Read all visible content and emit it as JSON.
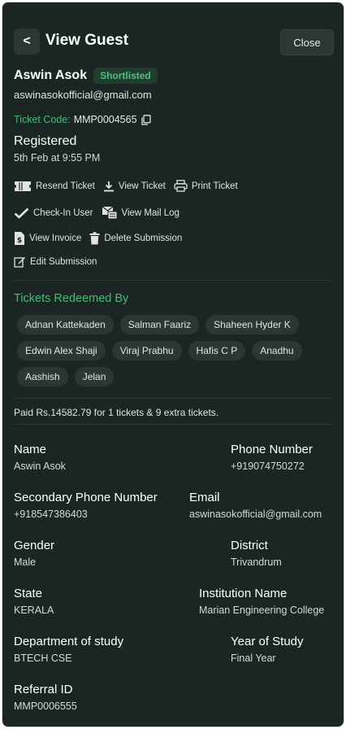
{
  "header": {
    "back_label": "<",
    "title": "View Guest",
    "close_label": "Close"
  },
  "guest": {
    "name": "Aswin Asok",
    "status_badge": "Shortlisted",
    "email": "aswinasokofficial@gmail.com",
    "ticket_code_label": "Ticket Code:",
    "ticket_code": "MMP0004565",
    "registration_status": "Registered",
    "registration_date": "5th Feb at 9:55 PM"
  },
  "actions": {
    "resend_ticket": "Resend Ticket",
    "view_ticket": "View Ticket",
    "print_ticket": "Print Ticket",
    "check_in_user": "Check-In User",
    "view_mail_log": "View Mail Log",
    "view_invoice": "View Invoice",
    "delete_submission": "Delete Submission",
    "edit_submission": "Edit Submission"
  },
  "redeemed": {
    "title": "Tickets Redeemed By",
    "names": [
      "Adnan Kattekaden",
      "Salman Faariz",
      "Shaheen Hyder K",
      "Edwin Alex Shaji",
      "Viraj Prabhu",
      "Hafis C P",
      "Anadhu",
      "Aashish",
      "Jelan"
    ]
  },
  "payment_summary": "Paid Rs.14582.79 for 1 tickets & 9 extra tickets.",
  "details": {
    "name": {
      "label": "Name",
      "value": "Aswin Asok"
    },
    "phone": {
      "label": "Phone Number",
      "value": "+919074750272"
    },
    "secondary_phone": {
      "label": "Secondary Phone Number",
      "value": "+918547386403"
    },
    "email": {
      "label": "Email",
      "value": "aswinasokofficial@gmail.com"
    },
    "gender": {
      "label": "Gender",
      "value": "Male"
    },
    "district": {
      "label": "District",
      "value": "Trivandrum"
    },
    "state": {
      "label": "State",
      "value": "KERALA"
    },
    "institution": {
      "label": "Institution Name",
      "value": "Marian Engineering College"
    },
    "department": {
      "label": "Department of study",
      "value": "BTECH CSE"
    },
    "year": {
      "label": "Year of Study",
      "value": "Final Year"
    },
    "referral": {
      "label": "Referral ID",
      "value": "MMP0006555"
    }
  },
  "colors": {
    "background": "#1b2523",
    "accent_green": "#3fbf74",
    "badge_bg": "#223c30",
    "chip_bg": "#2c3735"
  }
}
